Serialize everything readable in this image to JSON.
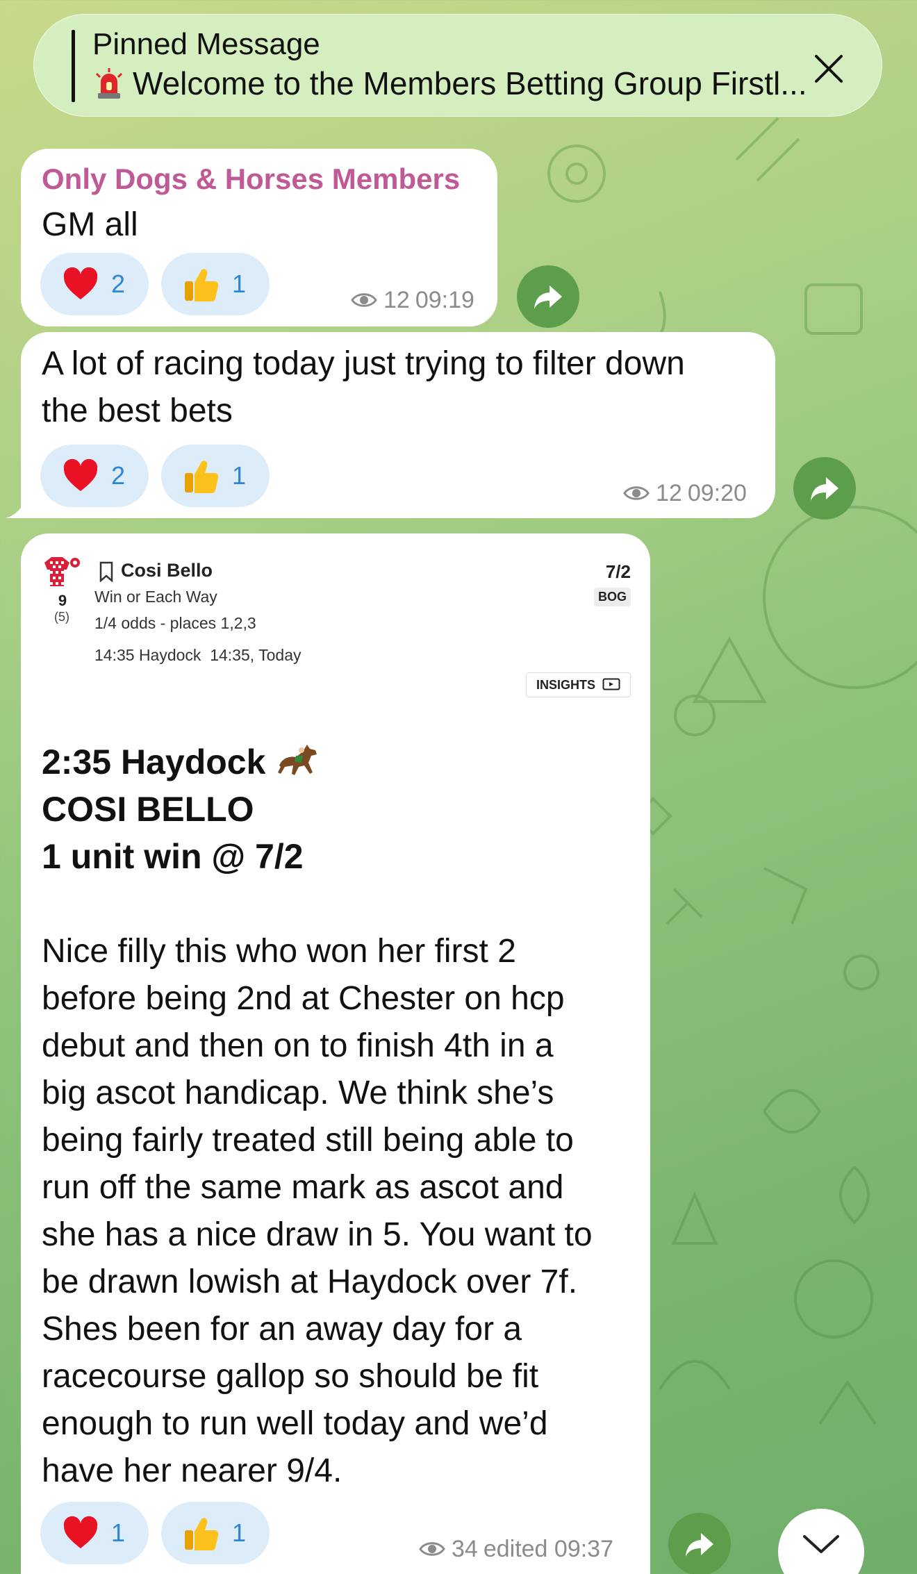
{
  "pinned": {
    "title": "Pinned Message",
    "text": "Welcome to the Members Betting Group Firstl..."
  },
  "messages": [
    {
      "sender": "Only Dogs & Horses Members",
      "lines": [
        "GM all"
      ],
      "reactions": [
        {
          "emoji": "red-heart",
          "count": "2"
        },
        {
          "emoji": "thumbs-up",
          "count": "1"
        }
      ],
      "views": "12",
      "time": "09:19"
    },
    {
      "lines": [
        "A lot of racing today just trying to filter down",
        "the best bets"
      ],
      "reactions": [
        {
          "emoji": "red-heart",
          "count": "2"
        },
        {
          "emoji": "thumbs-up",
          "count": "1"
        }
      ],
      "views": "12",
      "time": "09:20"
    },
    {
      "betslip": {
        "runner_number": "9",
        "draw": "(5)",
        "horse": "Cosi Bello",
        "bet_type": "Win or Each Way",
        "terms": "1/4 odds - places 1,2,3",
        "race": "14:35 Haydock  14:35, Today",
        "odds": "7/2",
        "bog": "BOG",
        "insights": "INSIGHTS"
      },
      "tip_lines": [
        "2:35 Haydock",
        "COSI BELLO",
        "1 unit win @ 7/2"
      ],
      "body_lines": [
        "Nice filly this who won her first 2",
        "before being 2nd at Chester on hcp",
        "debut and then on to finish 4th in a",
        "big ascot handicap. We think she’s",
        "being fairly treated still being able to",
        "run off the same mark as ascot and",
        "she has a nice draw in 5. You want to",
        "be drawn lowish at Haydock over 7f.",
        "Shes been for an away day for a",
        "racecourse gallop so should be fit",
        "enough to run well today and we’d",
        "have her nearer 9/4."
      ],
      "reactions": [
        {
          "emoji": "red-heart",
          "count": "1"
        },
        {
          "emoji": "thumbs-up",
          "count": "1"
        }
      ],
      "views": "34",
      "time": "edited 09:37"
    }
  ],
  "colors": {
    "sender": "#c05a96",
    "reaction_bg": "#dcecf9",
    "reaction_count": "#2f86d4",
    "share_button": "#5d9e4d"
  },
  "icons": [
    "siren-icon",
    "close-icon",
    "eye-icon",
    "share-icon",
    "bookmark-icon",
    "silks-icon",
    "tv-icon",
    "horse-racing-icon",
    "chevron-down-icon"
  ]
}
